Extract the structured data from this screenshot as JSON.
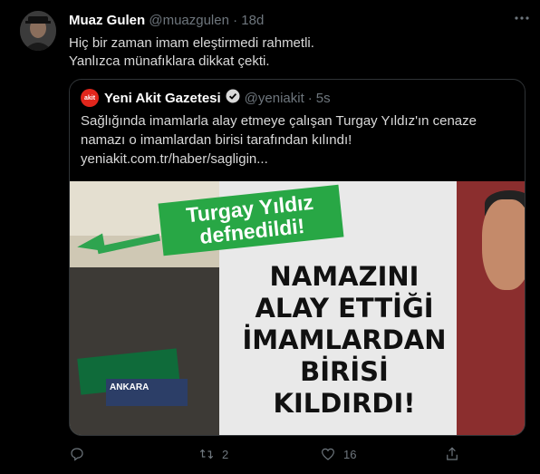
{
  "tweet": {
    "author_name": "Muaz Gulen",
    "author_handle": "@muazgulen",
    "time_separator": "·",
    "time": "18d",
    "text_lines": [
      "Hiç bir zaman imam eleştirmedi rahmetli.",
      "Yanlızca münafıklara dikkat çekti."
    ]
  },
  "quote": {
    "logo_text": "akit",
    "author_name": "Yeni Akit Gazetesi",
    "author_handle": "@yeniakit",
    "time_separator": "·",
    "time": "5s",
    "text_lines": [
      "Sağlığında imamlarla alay etmeye çalışan Turgay Yıldız'ın cenaze",
      "namazı o imamlardan birisi tarafından kılındı!",
      "yeniakit.com.tr/haber/sagligin..."
    ],
    "image": {
      "banner_lines": [
        "Turgay Yıldız",
        "defnedildi!"
      ],
      "headline_lines": [
        "NAMAZINI",
        "ALAY ETTİĞİ",
        "İMAMLARDAN",
        "BİRİSİ",
        "KILDIRDI!"
      ],
      "sign_text": "ANKARA"
    }
  },
  "actions": {
    "reply_count": "",
    "retweet_count": "2",
    "like_count": "16"
  },
  "colors": {
    "background": "#000000",
    "muted": "#6e767d",
    "brand_green": "#28a745",
    "akit_red": "#e1261c"
  }
}
